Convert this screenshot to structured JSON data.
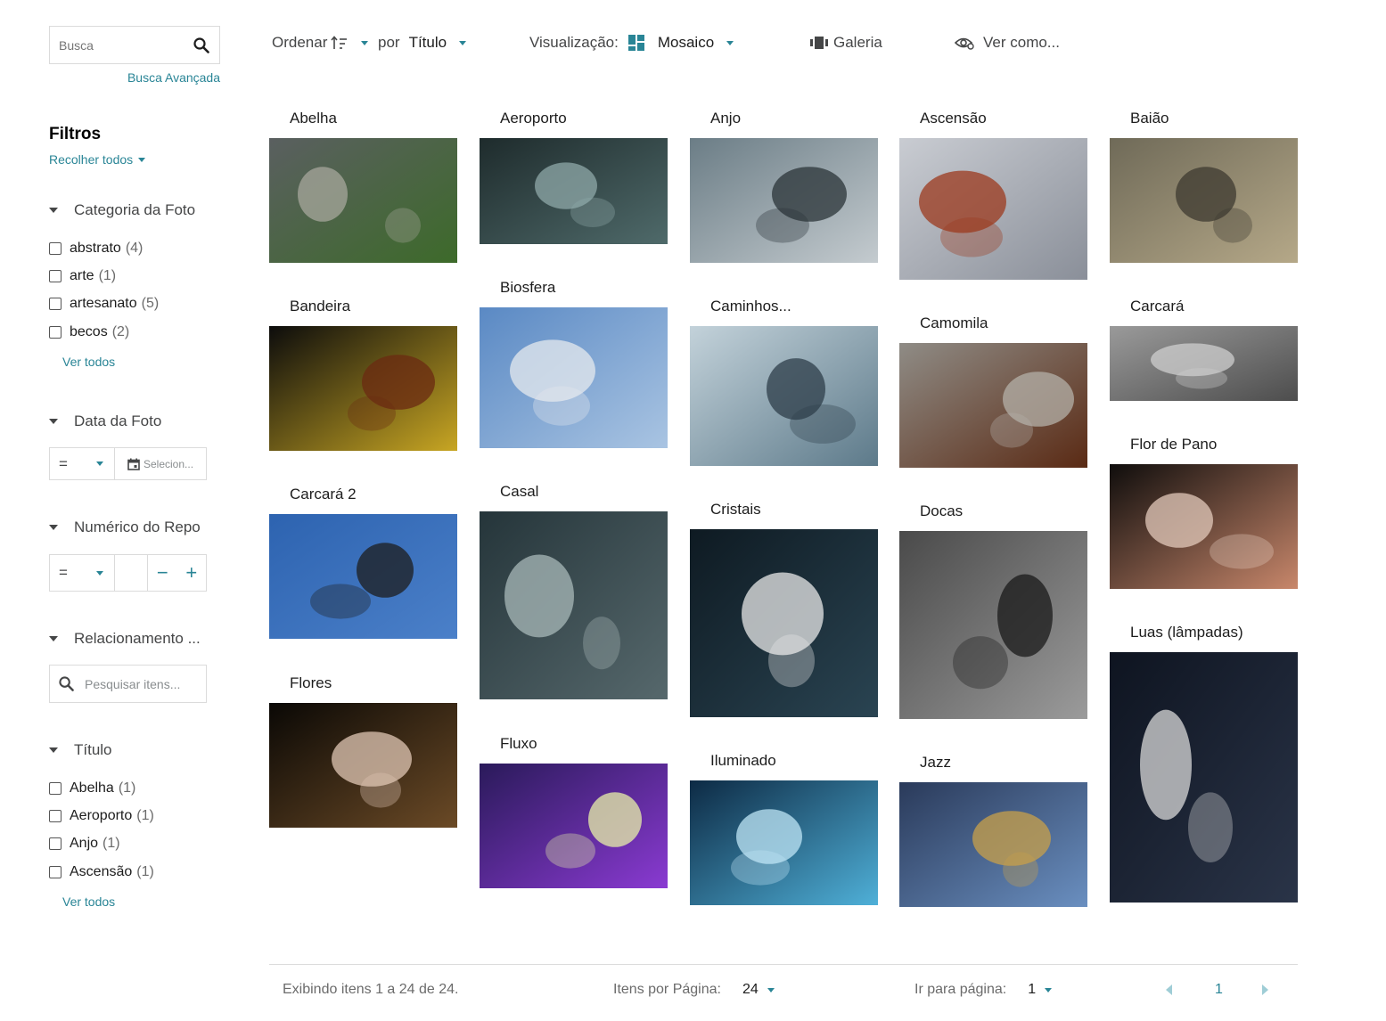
{
  "search": {
    "placeholder": "Busca",
    "advanced_label": "Busca Avançada"
  },
  "filters": {
    "title": "Filtros",
    "collapse_all": "Recolher todos",
    "category": {
      "label": "Categoria da Foto",
      "items": [
        {
          "label": "abstrato",
          "count": "(4)"
        },
        {
          "label": "arte",
          "count": "(1)"
        },
        {
          "label": "artesanato",
          "count": "(5)"
        },
        {
          "label": "becos",
          "count": "(2)"
        }
      ],
      "see_all": "Ver todos"
    },
    "date": {
      "label": "Data da Foto",
      "operator": "=",
      "placeholder": "Selecion..."
    },
    "numeric": {
      "label": "Numérico do Repo",
      "operator": "=",
      "minus": "−",
      "plus": "+"
    },
    "relation": {
      "label": "Relacionamento ...",
      "placeholder": "Pesquisar itens..."
    },
    "title_filter": {
      "label": "Título",
      "items": [
        {
          "label": "Abelha",
          "count": "(1)"
        },
        {
          "label": "Aeroporto",
          "count": "(1)"
        },
        {
          "label": "Anjo",
          "count": "(1)"
        },
        {
          "label": "Ascensão",
          "count": "(1)"
        }
      ],
      "see_all": "Ver todos"
    }
  },
  "toolbar": {
    "sort_label": "Ordenar",
    "by_label": "por",
    "sort_field": "Título",
    "view_label": "Visualização:",
    "view_mode": "Mosaico",
    "gallery_label": "Galeria",
    "view_as_label": "Ver como..."
  },
  "items": [
    {
      "title": "Abelha",
      "colors": [
        "#5a5f60",
        "#3d6a2a",
        "#a7a79c"
      ]
    },
    {
      "title": "Aeroporto",
      "colors": [
        "#1e2b2c",
        "#4f6a6a",
        "#8fa8a8"
      ]
    },
    {
      "title": "Anjo",
      "colors": [
        "#6b7d86",
        "#c4cbcf",
        "#2b3438"
      ]
    },
    {
      "title": "Ascensão",
      "colors": [
        "#c9ccd2",
        "#8a8f99",
        "#9c3a1e"
      ]
    },
    {
      "title": "Baião",
      "colors": [
        "#6f6a58",
        "#b5a888",
        "#3d3a30"
      ]
    },
    {
      "title": "Bandeira",
      "colors": [
        "#0c0c0c",
        "#c8a623",
        "#6b2a12"
      ]
    },
    {
      "title": "Biosfera",
      "colors": [
        "#5a89c4",
        "#a9c4e2",
        "#e6e9ee"
      ]
    },
    {
      "title": "Caminhos...",
      "colors": [
        "#c3d2da",
        "#5d7a8a",
        "#2e3e4a"
      ]
    },
    {
      "title": "Camomila",
      "colors": [
        "#8f8c86",
        "#5a2a14",
        "#b4b0a8"
      ]
    },
    {
      "title": "Carcará",
      "colors": [
        "#9a9a9a",
        "#4d4d4d",
        "#cfcfcf"
      ]
    },
    {
      "title": "Carcará 2",
      "colors": [
        "#2d63b0",
        "#4b80c9",
        "#1d1d1d"
      ]
    },
    {
      "title": "Casal",
      "colors": [
        "#25353a",
        "#56686c",
        "#a8b8b8"
      ]
    },
    {
      "title": "Cristais",
      "colors": [
        "#0e1a22",
        "#2a4452",
        "#e8e8e8"
      ]
    },
    {
      "title": "Docas",
      "colors": [
        "#4a4a4a",
        "#9b9b9b",
        "#1a1a1a"
      ]
    },
    {
      "title": "Flor de Pano",
      "colors": [
        "#0f0d0c",
        "#c8876b",
        "#e3c9bb"
      ]
    },
    {
      "title": "Flores",
      "colors": [
        "#0a0805",
        "#6b4a26",
        "#e0c7b4"
      ]
    },
    {
      "title": "Fluxo",
      "colors": [
        "#2a1a5a",
        "#8a3ad2",
        "#e8f0a8"
      ]
    },
    {
      "title": "Iluminado",
      "colors": [
        "#0d2a44",
        "#4fb0d8",
        "#bfe6f5"
      ]
    },
    {
      "title": "Jazz",
      "colors": [
        "#2a3a5a",
        "#6a8fc0",
        "#c8a04a"
      ]
    },
    {
      "title": "Luas (lâmpadas)",
      "colors": [
        "#0e1420",
        "#2a3448",
        "#d8d8d8"
      ]
    }
  ],
  "footer": {
    "showing": "Exibindo itens 1 a 24 de 24.",
    "per_page_label": "Itens por Página:",
    "per_page_value": "24",
    "goto_label": "Ir para página:",
    "goto_value": "1",
    "current_page": "1"
  }
}
